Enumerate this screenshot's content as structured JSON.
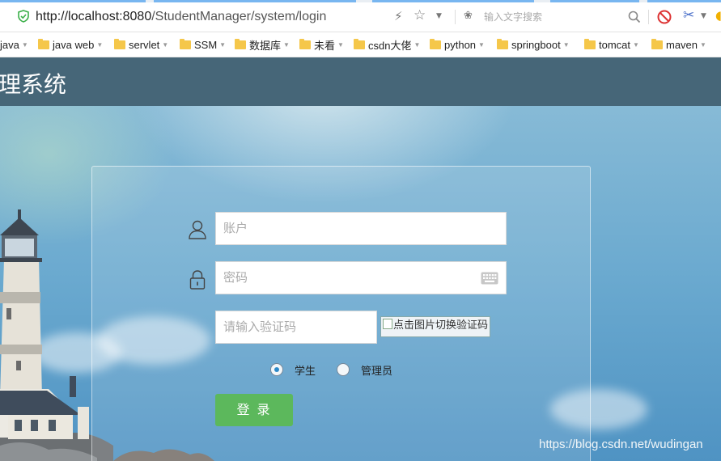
{
  "browser": {
    "url_host": "http://localhost:8080",
    "url_path": "/StudentManager/system/login",
    "search_placeholder": "输入文字搜索"
  },
  "bookmarks": [
    {
      "label": "java"
    },
    {
      "label": "java web"
    },
    {
      "label": "servlet"
    },
    {
      "label": "SSM"
    },
    {
      "label": "数据库"
    },
    {
      "label": "未看"
    },
    {
      "label": "csdn大佬"
    },
    {
      "label": "python"
    },
    {
      "label": "springboot"
    },
    {
      "label": "tomcat"
    },
    {
      "label": "maven"
    }
  ],
  "header": {
    "title": "理系统"
  },
  "login": {
    "account_placeholder": "账户",
    "password_placeholder": "密码",
    "captcha_placeholder": "请输入验证码",
    "captcha_alt": "点击图片切换验证码",
    "role_student": "学生",
    "role_admin": "管理员",
    "submit_label": "登  录"
  },
  "watermark": "https://blog.csdn.net/wudingan",
  "colors": {
    "header_bg": "#466678",
    "login_button": "#5cb85c",
    "radio_accent": "#2d89c8"
  }
}
